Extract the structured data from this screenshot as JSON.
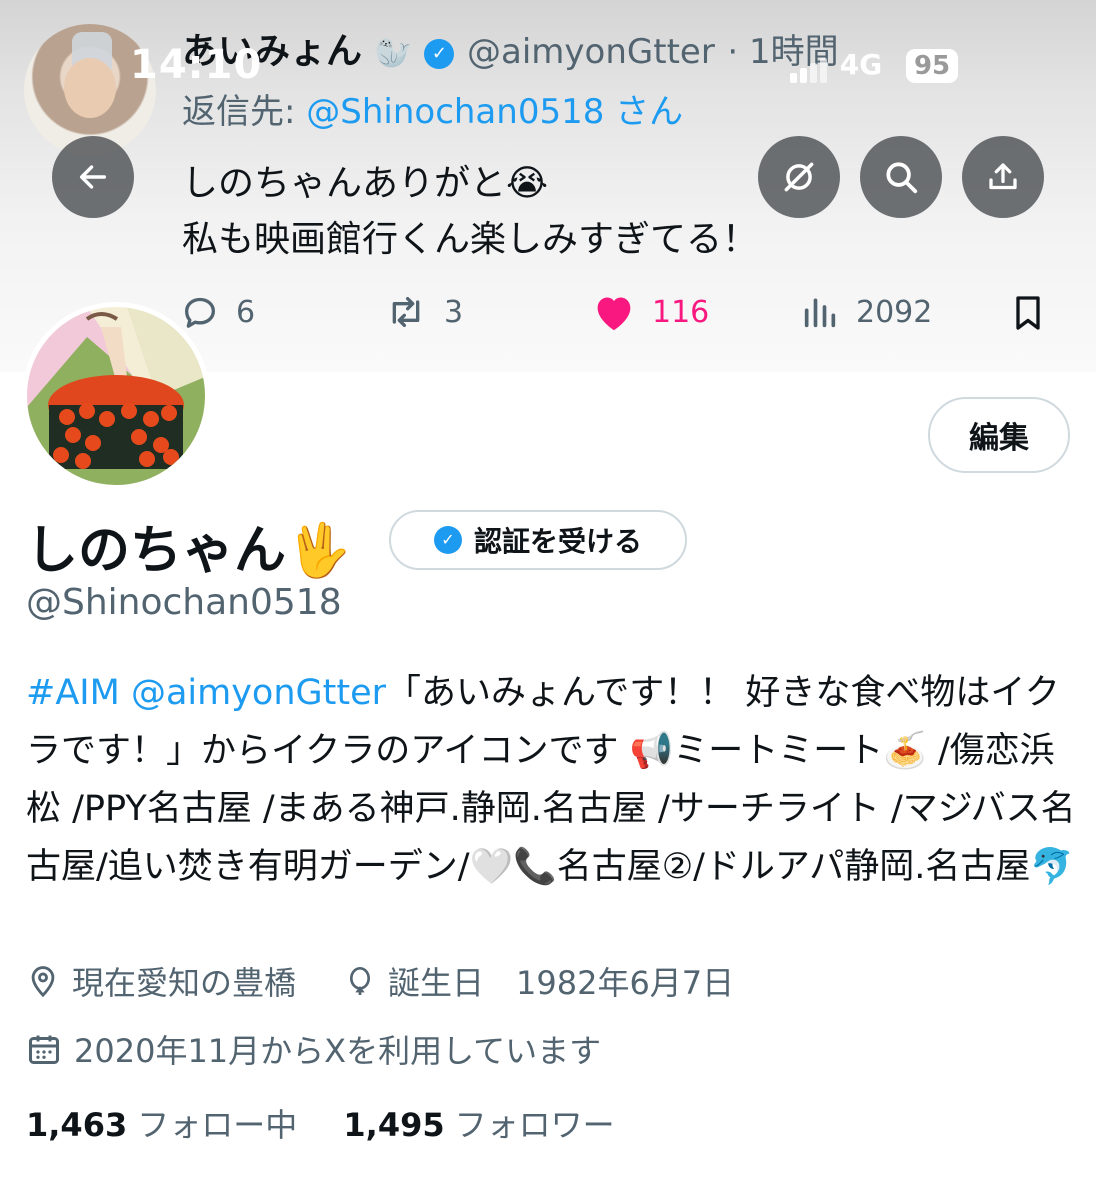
{
  "status_bar": {
    "time": "14:10",
    "network": "4G",
    "battery": "95"
  },
  "tweet": {
    "author_name": "あいみょん",
    "author_emoji": "🦭",
    "author_handle": "@aimyonGtter",
    "time_ago": "· 1時間",
    "reply_prefix": "返信先: ",
    "reply_mention": "@Shinochan0518",
    "reply_suffix": " さん",
    "text_line1": "しのちゃんありがと😭",
    "text_line2": "私も映画館行くん楽しみすぎてる！",
    "stats": {
      "replies": "6",
      "retweets": "3",
      "likes": "116",
      "views": "2092"
    }
  },
  "profile": {
    "display_name": "しのちゃん🖖",
    "get_verified_label": "認証を受ける",
    "edit_label": "編集",
    "handle": "@Shinochan0518",
    "bio_hashtag": "#AIM",
    "bio_mention": "@aimyonGtter",
    "bio_text": "「あいみょんです！！ 好きな食べ物はイクラです！」からイクラのアイコンです 📢ミートミート🍝 /傷恋浜松 /PPY名古屋 /まある神戸.静岡.名古屋 /サーチライト /マジバス名古屋/追い焚き有明ガーデン/🤍📞名古屋②/ドルアパ静岡.名古屋🐬",
    "location": "現在愛知の豊橋",
    "birthday": "誕生日　1982年6月7日",
    "joined": "2020年11月からXを利用しています",
    "following_count": "1,463",
    "following_label": "フォロー中",
    "followers_count": "1,495",
    "followers_label": "フォロワー"
  },
  "colors": {
    "accent": "#1d9bf0",
    "like": "#f91880",
    "secondary_text": "#536471"
  }
}
